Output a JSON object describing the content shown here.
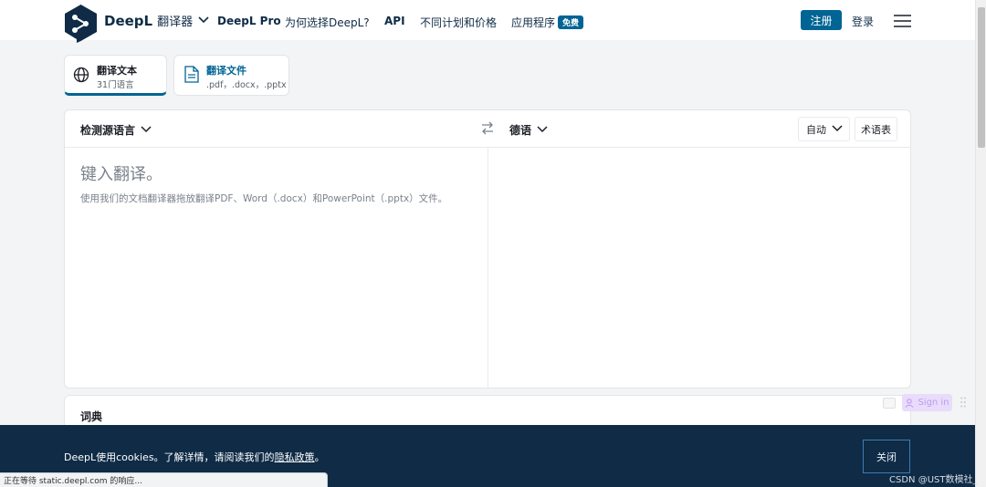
{
  "header": {
    "brand_name": "DeepL",
    "brand_sub": "翻译器",
    "nav": [
      "DeepL Pro",
      "为何选择DeepL?",
      "API",
      "不同计划和价格",
      "应用程序"
    ],
    "apps_badge": "免费",
    "register": "注册",
    "login": "登录"
  },
  "tabs": [
    {
      "title": "翻译文本",
      "sub": "31门语言"
    },
    {
      "title": "翻译文件",
      "sub": ".pdf，.docx，.pptx"
    }
  ],
  "translator": {
    "source_lang": "检测源语言",
    "target_lang": "德语",
    "tone": "自动",
    "glossary": "术语表",
    "placeholder": "键入翻译。",
    "hint": "使用我们的文档翻译器拖放翻译PDF、Word（.docx）和PowerPoint（.pptx）文件。"
  },
  "dictionary": {
    "title": "词典"
  },
  "floating": {
    "sign_in": "Sign in"
  },
  "cookie": {
    "text_before": "DeepL使用cookies。了解详情，请阅读我们的",
    "link": "隐私政策",
    "text_after": "。",
    "close": "关闭"
  },
  "watermark": "CSDN @UST数模社_",
  "statusbar": "正在等待 static.deepl.com 的响应..."
}
